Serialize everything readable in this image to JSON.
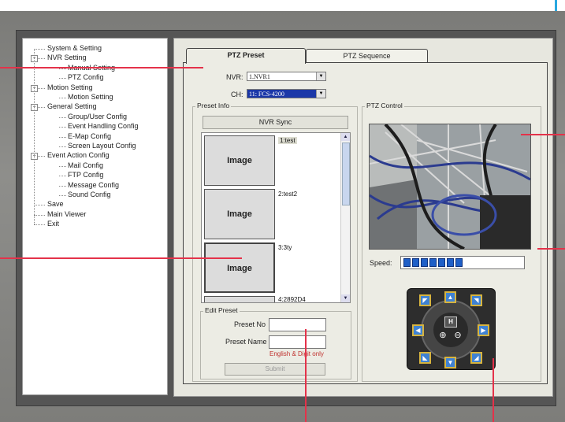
{
  "tree": {
    "items": [
      {
        "label": "System & Setting",
        "level": 0,
        "expander": ""
      },
      {
        "label": "NVR  Setting",
        "level": 0,
        "expander": "−"
      },
      {
        "label": "Manual Setting",
        "level": 1,
        "expander": ""
      },
      {
        "label": "PTZ Config",
        "level": 1,
        "expander": ""
      },
      {
        "label": "Motion Setting",
        "level": 0,
        "expander": "−"
      },
      {
        "label": "Motion Setting",
        "level": 1,
        "expander": ""
      },
      {
        "label": "General Setting",
        "level": 0,
        "expander": "−"
      },
      {
        "label": "Group/User Config",
        "level": 1,
        "expander": ""
      },
      {
        "label": "Event Handling Config",
        "level": 1,
        "expander": ""
      },
      {
        "label": "E-Map Config",
        "level": 1,
        "expander": ""
      },
      {
        "label": "Screen Layout Config",
        "level": 1,
        "expander": ""
      },
      {
        "label": "Event Action Config",
        "level": 0,
        "expander": "−"
      },
      {
        "label": "Mail Config",
        "level": 1,
        "expander": ""
      },
      {
        "label": "FTP Config",
        "level": 1,
        "expander": ""
      },
      {
        "label": "Message Config",
        "level": 1,
        "expander": ""
      },
      {
        "label": "Sound Config",
        "level": 1,
        "expander": ""
      },
      {
        "label": "Save",
        "level": 0,
        "expander": ""
      },
      {
        "label": "Main Viewer",
        "level": 0,
        "expander": ""
      },
      {
        "label": "Exit",
        "level": 0,
        "expander": ""
      }
    ]
  },
  "tabs": [
    {
      "label": "PTZ Preset",
      "active": true
    },
    {
      "label": "PTZ Sequence",
      "active": false
    }
  ],
  "form": {
    "nvr_label": "NVR:",
    "nvr_value": "1.NVR1",
    "ch_label": "CH:",
    "ch_value": "11: FCS-4200"
  },
  "preset_info": {
    "title": "Preset Info",
    "sync_button": "NVR  Sync",
    "items": [
      {
        "image": "Image",
        "name": "1:test"
      },
      {
        "image": "Image",
        "name": "2:test2"
      },
      {
        "image": "Image",
        "name": "3:3ty"
      },
      {
        "image": "",
        "name": "4:2892D4"
      }
    ]
  },
  "edit_preset": {
    "title": "Edit Preset",
    "preset_no_label": "Preset No",
    "preset_name_label": "Preset Name",
    "hint": "English & Digit only",
    "submit": "Submit"
  },
  "ptz_control": {
    "title": "PTZ Control",
    "speed_label": "Speed:",
    "speed_level": 7,
    "speed_max": 21,
    "home_label": "H"
  },
  "colors": {
    "callout": "#e4324a",
    "accent_blue": "#1f5fc7",
    "hint_red": "#c0322f"
  }
}
